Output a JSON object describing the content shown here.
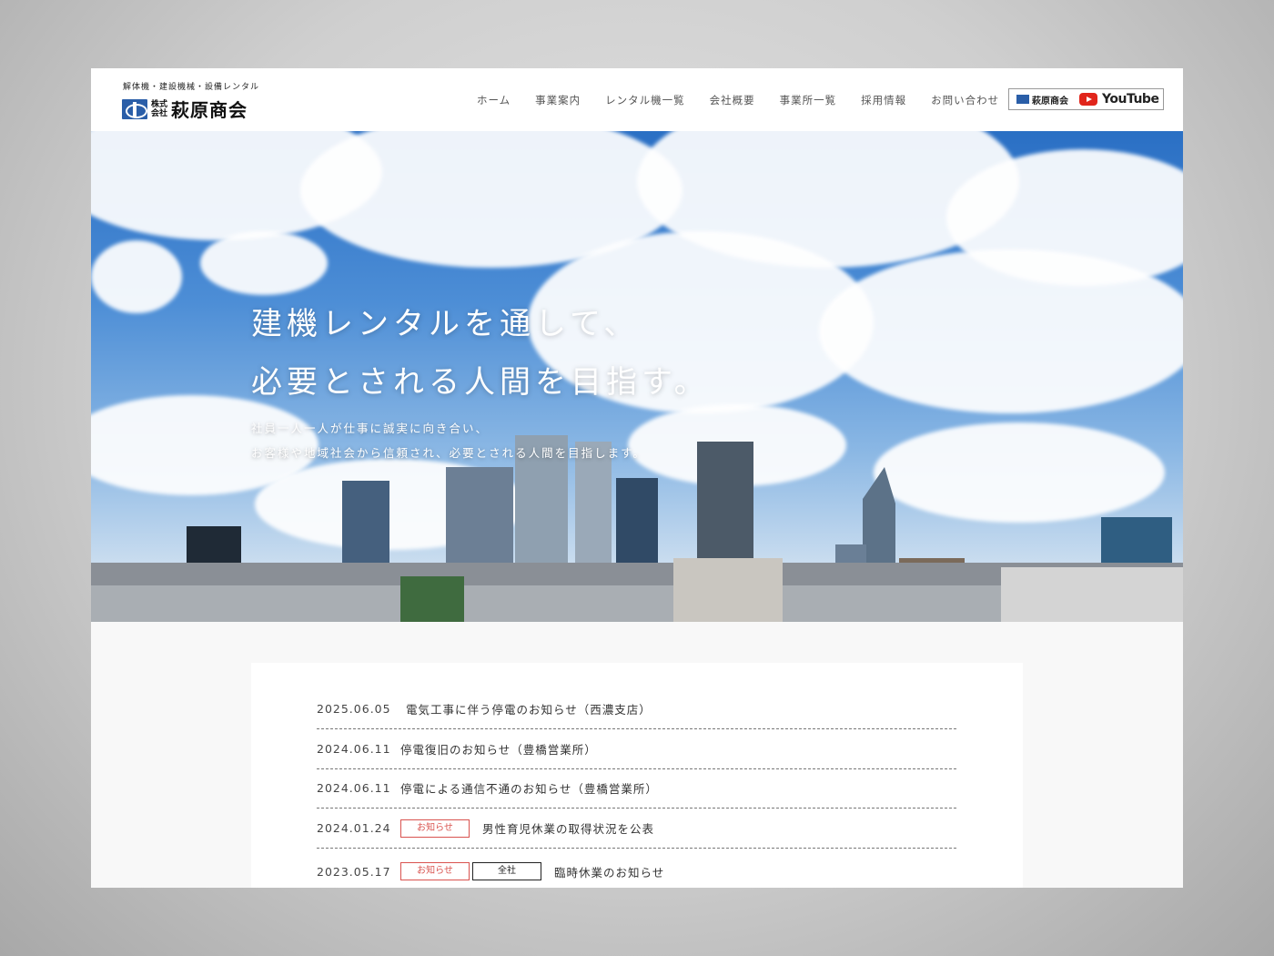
{
  "header": {
    "tagline": "解体機・建設機械・設備レンタル",
    "logo_kind": "株式会社",
    "logo_name": "萩原商会",
    "nav": [
      "ホーム",
      "事業案内",
      "レンタル機一覧",
      "会社概要",
      "事業所一覧",
      "採用情報",
      "お問い合わせ"
    ],
    "youtube_banner": {
      "company": "萩原商会",
      "label": "YouTube"
    }
  },
  "hero": {
    "title_line1": "建機レンタルを通して、",
    "title_line2": "必要とされる人間を目指す。",
    "sub_line1": "社員一人一人が仕事に誠実に向き合い、",
    "sub_line2": "お客様や地域社会から信頼され、必要とされる人間を目指します。"
  },
  "news": {
    "items": [
      {
        "date": "2025.06.05",
        "badges": [],
        "title": "電気工事に伴う停電のお知らせ（西濃支店）"
      },
      {
        "date": "2024.06.11",
        "badges": [],
        "title": "停電復旧のお知らせ（豊橋営業所）"
      },
      {
        "date": "2024.06.11",
        "badges": [],
        "title": "停電による通信不通のお知らせ（豊橋営業所）"
      },
      {
        "date": "2024.01.24",
        "badges": [
          "お知らせ"
        ],
        "title": "男性育児休業の取得状況を公表"
      },
      {
        "date": "2023.05.17",
        "badges": [
          "お知らせ",
          "全社"
        ],
        "title": "臨時休業のお知らせ"
      }
    ]
  },
  "colors": {
    "accent_red": "#d9534f",
    "brand_blue": "#2a5ea8",
    "youtube_red": "#e1251b"
  }
}
